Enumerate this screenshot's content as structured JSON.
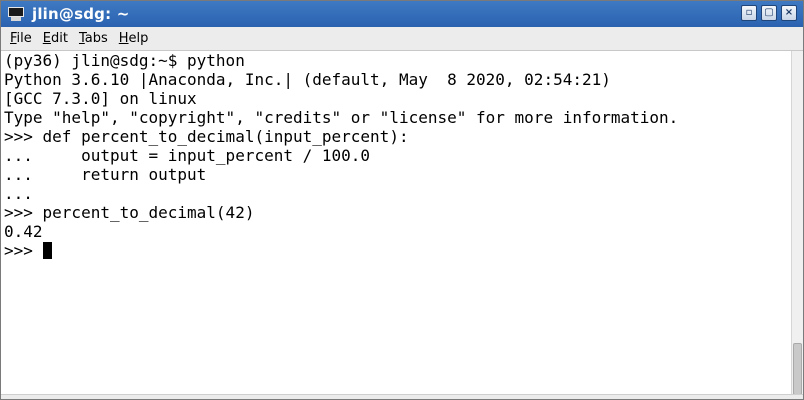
{
  "window": {
    "title": "jlin@sdg: ~",
    "title_icon": "terminal-icon",
    "controls": {
      "minimize": "▫",
      "maximize": "▢",
      "close": "×"
    },
    "title_bar_color": "#3d73bd"
  },
  "menu": {
    "file": {
      "ul": "F",
      "rest": "ile"
    },
    "edit": {
      "ul": "E",
      "rest": "dit"
    },
    "tabs": {
      "ul": "T",
      "rest": "abs"
    },
    "help": {
      "ul": "H",
      "rest": "elp"
    }
  },
  "terminal": {
    "lines": [
      "(py36) jlin@sdg:~$ python",
      "Python 3.6.10 |Anaconda, Inc.| (default, May  8 2020, 02:54:21)",
      "[GCC 7.3.0] on linux",
      "Type \"help\", \"copyright\", \"credits\" or \"license\" for more information.",
      ">>> def percent_to_decimal(input_percent):",
      "...     output = input_percent / 100.0",
      "...     return output",
      "...",
      ">>> percent_to_decimal(42)",
      "0.42"
    ],
    "prompt": ">>> "
  }
}
